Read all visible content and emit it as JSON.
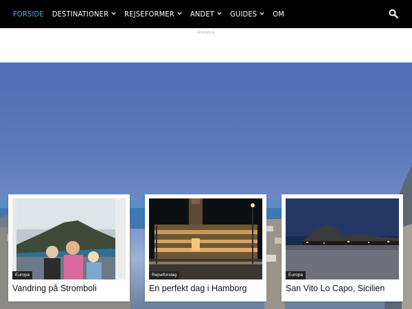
{
  "nav": {
    "items": [
      {
        "label": "Forside",
        "dropdown": false,
        "active": true
      },
      {
        "label": "Destinationer",
        "dropdown": true,
        "active": false
      },
      {
        "label": "Rejseformer",
        "dropdown": true,
        "active": false
      },
      {
        "label": "Andet",
        "dropdown": true,
        "active": false
      },
      {
        "label": "Guides",
        "dropdown": true,
        "active": false
      },
      {
        "label": "Om",
        "dropdown": false,
        "active": false
      }
    ],
    "search_icon": "search-icon"
  },
  "ad": {
    "label": "Annonce"
  },
  "cards": [
    {
      "category": "Europa",
      "title": "Vandring på Stromboli"
    },
    {
      "category": "Rejseforslag",
      "title": "En perfekt dag i Hamborg"
    },
    {
      "category": "Europa",
      "title": "San Vito Lo Capo, Sicilien"
    }
  ],
  "colors": {
    "nav_bg": "#000000",
    "nav_active": "#4db2ec",
    "badge_bg": "#222222"
  }
}
